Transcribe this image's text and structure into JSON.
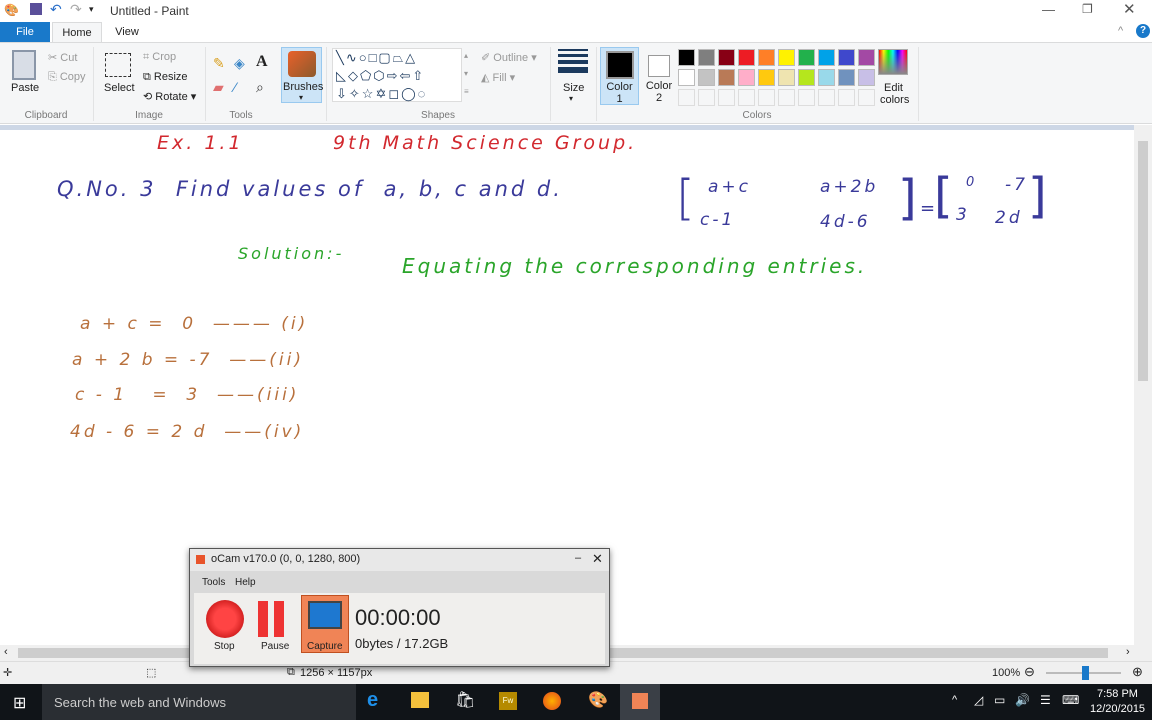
{
  "window": {
    "title": "Untitled - Paint"
  },
  "tabs": {
    "file": "File",
    "home": "Home",
    "view": "View"
  },
  "clipboard": {
    "paste": "Paste",
    "cut": "Cut",
    "copy": "Copy",
    "label": "Clipboard"
  },
  "image": {
    "select": "Select",
    "crop": "Crop",
    "resize": "Resize",
    "rotate": "Rotate",
    "label": "Image"
  },
  "tools": {
    "label": "Tools"
  },
  "brushes": {
    "label": "Brushes"
  },
  "shapes": {
    "outline": "Outline",
    "fill": "Fill",
    "label": "Shapes"
  },
  "size": {
    "label": "Size"
  },
  "colors": {
    "color1": "Color",
    "color1_num": "1",
    "color2": "Color",
    "color2_num": "2",
    "edit": "Edit",
    "edit2": "colors",
    "label": "Colors",
    "palette": [
      "#000000",
      "#7f7f7f",
      "#880015",
      "#ed1c24",
      "#ff7f27",
      "#fff200",
      "#22b14c",
      "#00a2e8",
      "#3f48cc",
      "#a349a4",
      "#ffffff",
      "#c3c3c3",
      "#b97a57",
      "#ffaec9",
      "#ffc90e",
      "#efe4b0",
      "#b5e61d",
      "#99d9ea",
      "#7092be",
      "#c8bfe7"
    ]
  },
  "canvas": {
    "title_left": "Ex. 1.1",
    "title_right": "9th Math Science Group.",
    "question": "Q.No. 3  Find values of  a, b, c and d.",
    "m1a": "a+c",
    "m1b": "a+2b",
    "m1c": "c-1",
    "m1d": "4d-6",
    "eq": "=",
    "m2a": "0",
    "m2b": "-7",
    "m2c": "3",
    "m2d": "2d",
    "solution": "Solution:-",
    "equating": "Equating the corresponding entries.",
    "lines": [
      "a + c =  0  ——— (i)",
      "a + 2 b = -7  ——(ii)",
      "c - 1   =  3  ——(iii)",
      "4d - 6 = 2 d  ——(iv)"
    ]
  },
  "status": {
    "size": "1256 × 1157px",
    "zoom": "100%"
  },
  "ocam": {
    "title": "oCam v170.0 (0, 0, 1280, 800)",
    "menu_tools": "Tools",
    "menu_help": "Help",
    "stop": "Stop",
    "pause": "Pause",
    "capture": "Capture",
    "time": "00:00:00",
    "storage": "0bytes / 17.2GB"
  },
  "taskbar": {
    "search": "Search the web and Windows",
    "time": "7:58 PM",
    "date": "12/20/2015"
  }
}
